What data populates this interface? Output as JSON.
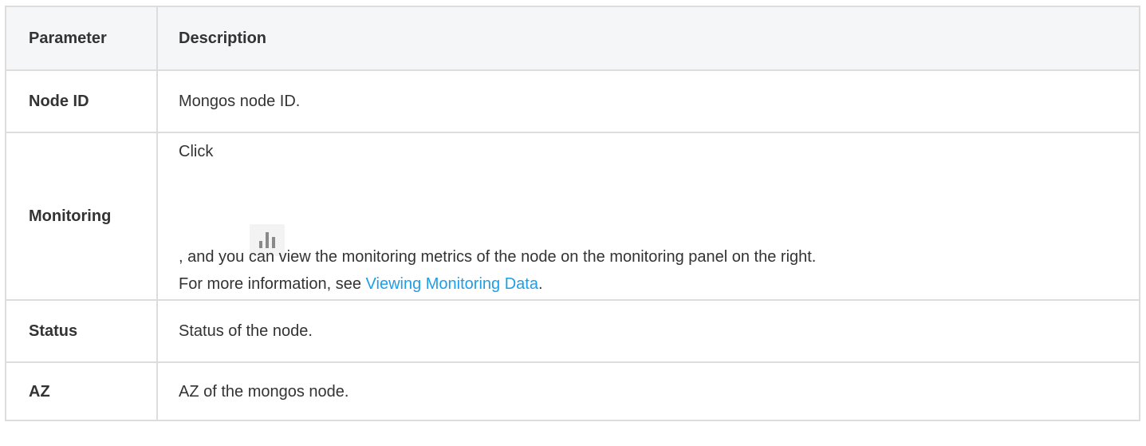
{
  "table": {
    "headers": {
      "parameter": "Parameter",
      "description": "Description"
    },
    "rows": [
      {
        "param": "Node ID",
        "desc": "Mongos node ID."
      },
      {
        "param": "Monitoring",
        "desc_prefix": "Click",
        "icon": "bar-chart-icon",
        "desc_after_icon": ", and you can view the monitoring metrics of the node on the monitoring panel on the right.",
        "desc_more_prefix": "For more information, see ",
        "link_text": "Viewing Monitoring Data",
        "desc_more_suffix": "."
      },
      {
        "param": "Status",
        "desc": "Status of the node."
      },
      {
        "param": "AZ",
        "desc": "AZ of the mongos node."
      }
    ]
  },
  "colors": {
    "link": "#1e9ee8",
    "text": "#333333",
    "border": "#dddddd",
    "header_bg": "#f5f6f8"
  }
}
